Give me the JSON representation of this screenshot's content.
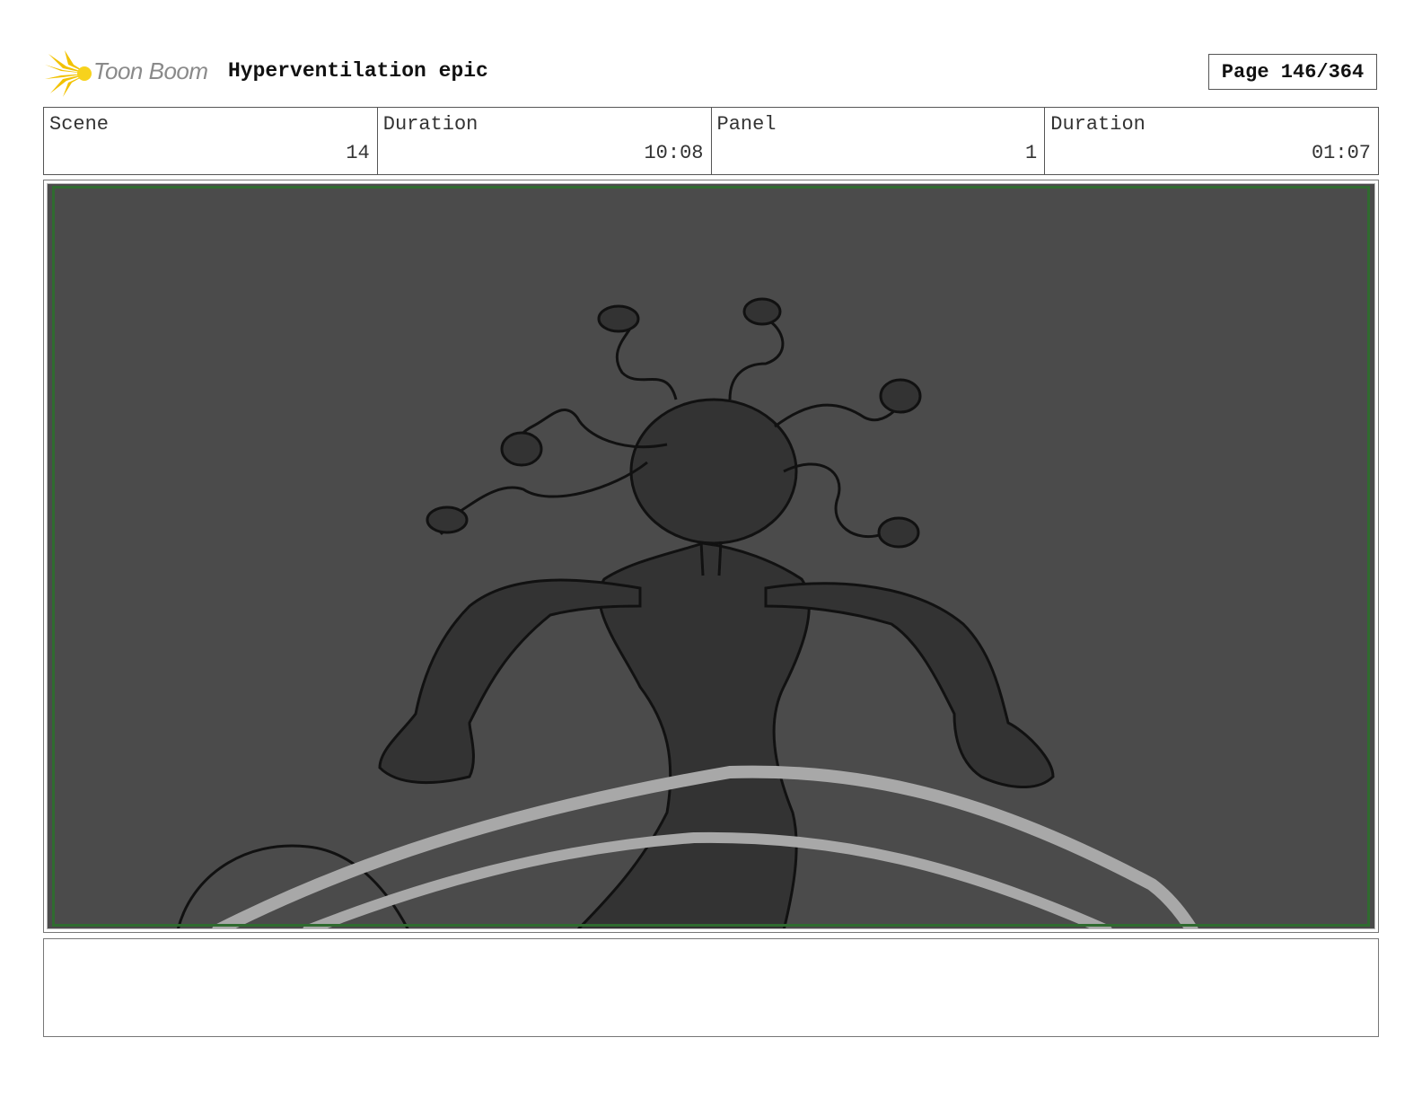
{
  "header": {
    "logo_text": "Toon Boom",
    "project_title": "Hyperventilation epic",
    "page_label": "Page 146/364"
  },
  "info": {
    "scene_label": "Scene",
    "scene_value": "14",
    "scene_duration_label": "Duration",
    "scene_duration_value": "10:08",
    "panel_label": "Panel",
    "panel_value": "1",
    "panel_duration_label": "Duration",
    "panel_duration_value": "01:07"
  },
  "panel_image": {
    "icon": "storyboard-sketch",
    "background_color": "#4b4b4b",
    "safe_frame_color": "#2f6b2f"
  },
  "notes": {
    "text": ""
  }
}
